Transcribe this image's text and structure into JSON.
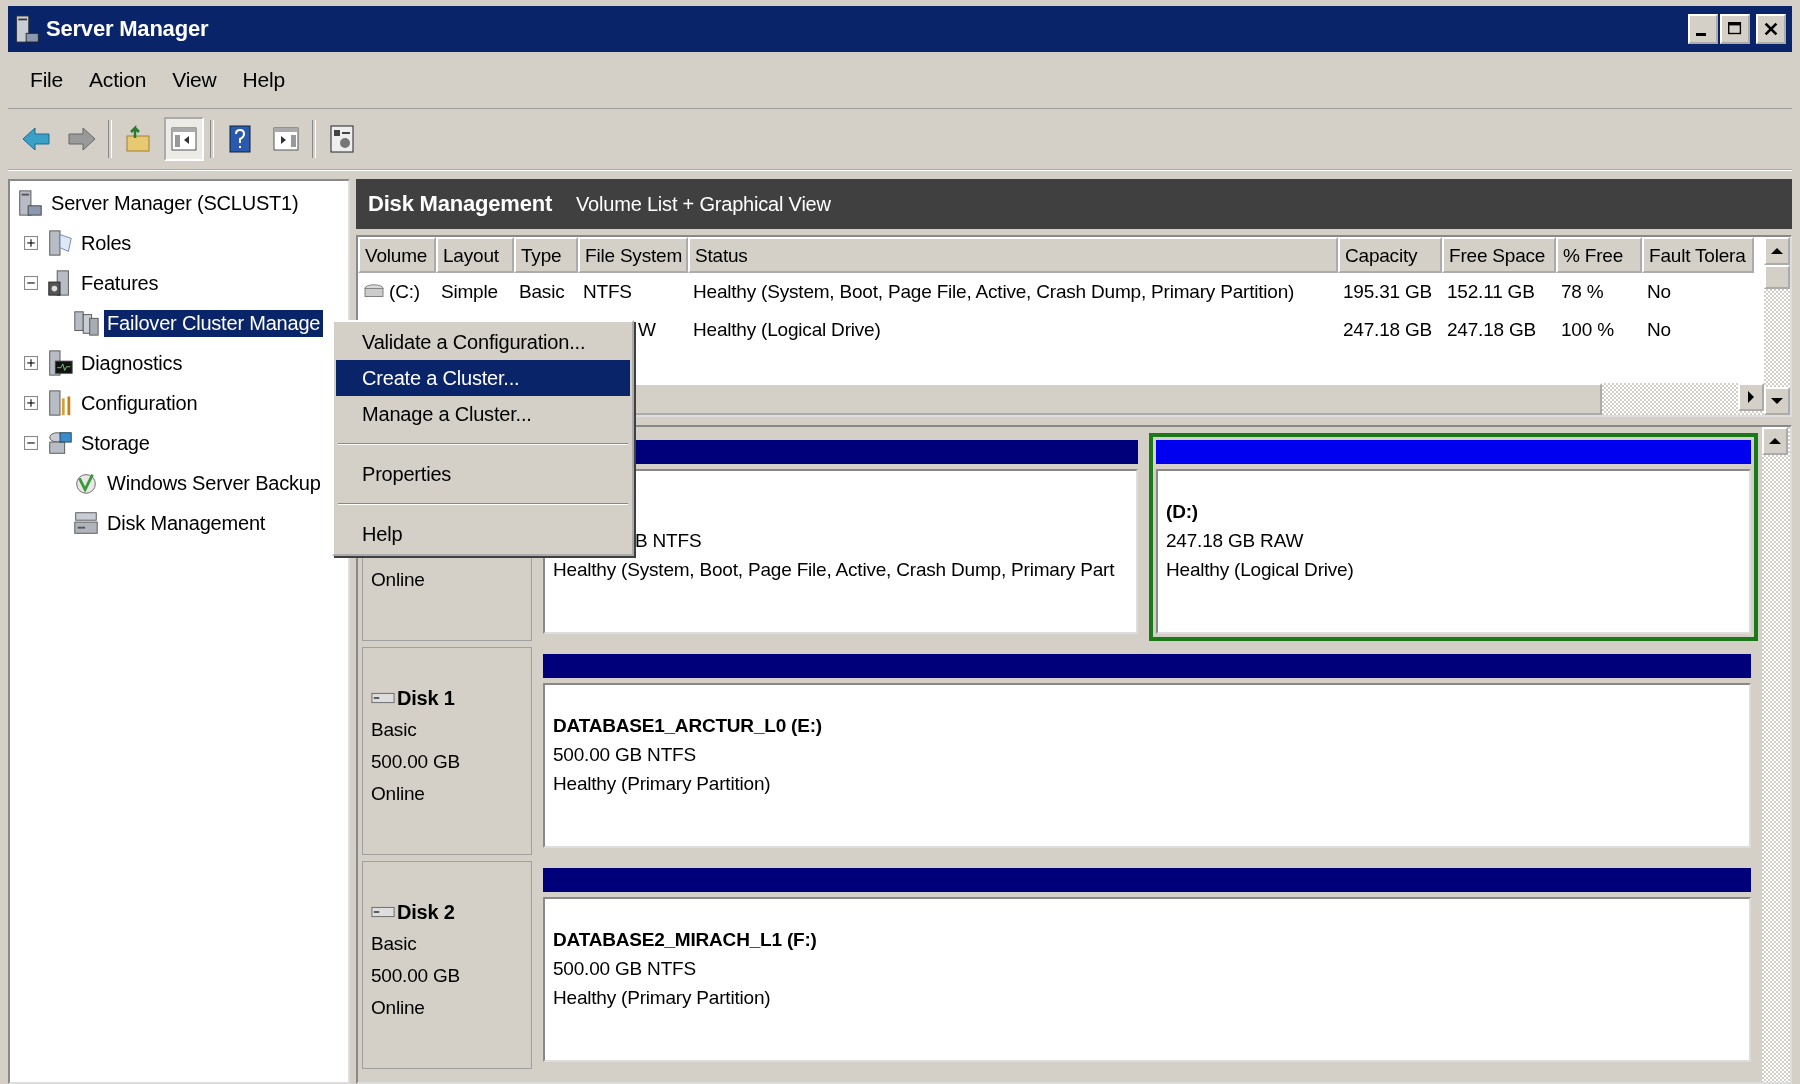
{
  "window": {
    "title": "Server Manager"
  },
  "menu_bar": [
    "File",
    "Action",
    "View",
    "Help"
  ],
  "toolbar": [
    {
      "kind": "back",
      "pressed": false
    },
    {
      "kind": "forward",
      "pressed": false
    },
    {
      "kind": "separator"
    },
    {
      "kind": "up",
      "pressed": false
    },
    {
      "kind": "tree",
      "pressed": true
    },
    {
      "kind": "separator"
    },
    {
      "kind": "help",
      "pressed": false
    },
    {
      "kind": "pane",
      "pressed": false
    },
    {
      "kind": "separator"
    },
    {
      "kind": "properties",
      "pressed": false
    }
  ],
  "tree": [
    {
      "label": "Server Manager (SCLUST1)",
      "kind": "server",
      "selected": false,
      "children": [
        {
          "label": "Roles",
          "kind": "roles",
          "expanded": false,
          "selected": false
        },
        {
          "label": "Features",
          "kind": "features",
          "expanded": true,
          "selected": false,
          "children": [
            {
              "label": "Failover Cluster Manage",
              "kind": "cluster",
              "selected": true
            }
          ]
        },
        {
          "label": "Diagnostics",
          "kind": "diagnostics",
          "expanded": false,
          "selected": false
        },
        {
          "label": "Configuration",
          "kind": "configuration",
          "expanded": false,
          "selected": false
        },
        {
          "label": "Storage",
          "kind": "storage",
          "expanded": true,
          "selected": false,
          "children": [
            {
              "label": "Windows Server Backup",
              "kind": "backup",
              "selected": false
            },
            {
              "label": "Disk Management",
              "kind": "disk",
              "selected": false
            }
          ]
        }
      ]
    }
  ],
  "panel_header": {
    "title": "Disk Management",
    "subtitle": "Volume List + Graphical View"
  },
  "volume_table": {
    "columns": [
      "Volume",
      "Layout",
      "Type",
      "File System",
      "Status",
      "Capacity",
      "Free Space",
      "% Free",
      "Fault Tolera"
    ],
    "rows": [
      {
        "volume": "(C:)",
        "layout": "Simple",
        "type": "Basic",
        "file_system": "NTFS",
        "status": "Healthy (System, Boot, Page File, Active, Crash Dump, Primary Partition)",
        "capacity": "195.31 GB",
        "free_space": "152.11 GB",
        "percent_free": "78 %",
        "fault_tolerance": "No"
      },
      {
        "file_system": "W",
        "status": "Healthy (Logical Drive)",
        "capacity": "247.18 GB",
        "free_space": "247.18 GB",
        "percent_free": "100 %",
        "fault_tolerance": "No"
      }
    ]
  },
  "disks": [
    {
      "status": "Online",
      "partitions": [
        {
          "kind": "primary",
          "selected": false,
          "size": "B NTFS",
          "health": "Healthy (System, Boot, Page File, Active, Crash Dump, Primary Part"
        },
        {
          "kind": "logical",
          "selected": true,
          "name": "(D:)",
          "size": "247.18 GB RAW",
          "health": "Healthy (Logical Drive)"
        }
      ]
    },
    {
      "name": "Disk 1",
      "type": "Basic",
      "capacity": "500.00 GB",
      "status": "Online",
      "partitions": [
        {
          "kind": "primary",
          "selected": false,
          "name": "DATABASE1_ARCTUR_L0  (E:)",
          "size": "500.00 GB NTFS",
          "health": "Healthy (Primary Partition)"
        }
      ]
    },
    {
      "name": "Disk 2",
      "type": "Basic",
      "capacity": "500.00 GB",
      "status": "Online",
      "partitions": [
        {
          "kind": "primary",
          "selected": false,
          "name": "DATABASE2_MIRACH_L1  (F:)",
          "size": "500.00 GB NTFS",
          "health": "Healthy (Primary Partition)"
        }
      ]
    }
  ],
  "context_menu": [
    {
      "kind": "item",
      "label": "Validate a Configuration...",
      "selected": false
    },
    {
      "kind": "item",
      "label": "Create a Cluster...",
      "selected": true
    },
    {
      "kind": "item",
      "label": "Manage a Cluster...",
      "selected": false
    },
    {
      "kind": "separator"
    },
    {
      "kind": "item",
      "label": "Properties",
      "selected": false
    },
    {
      "kind": "separator"
    },
    {
      "kind": "item",
      "label": "Help",
      "selected": false
    }
  ]
}
